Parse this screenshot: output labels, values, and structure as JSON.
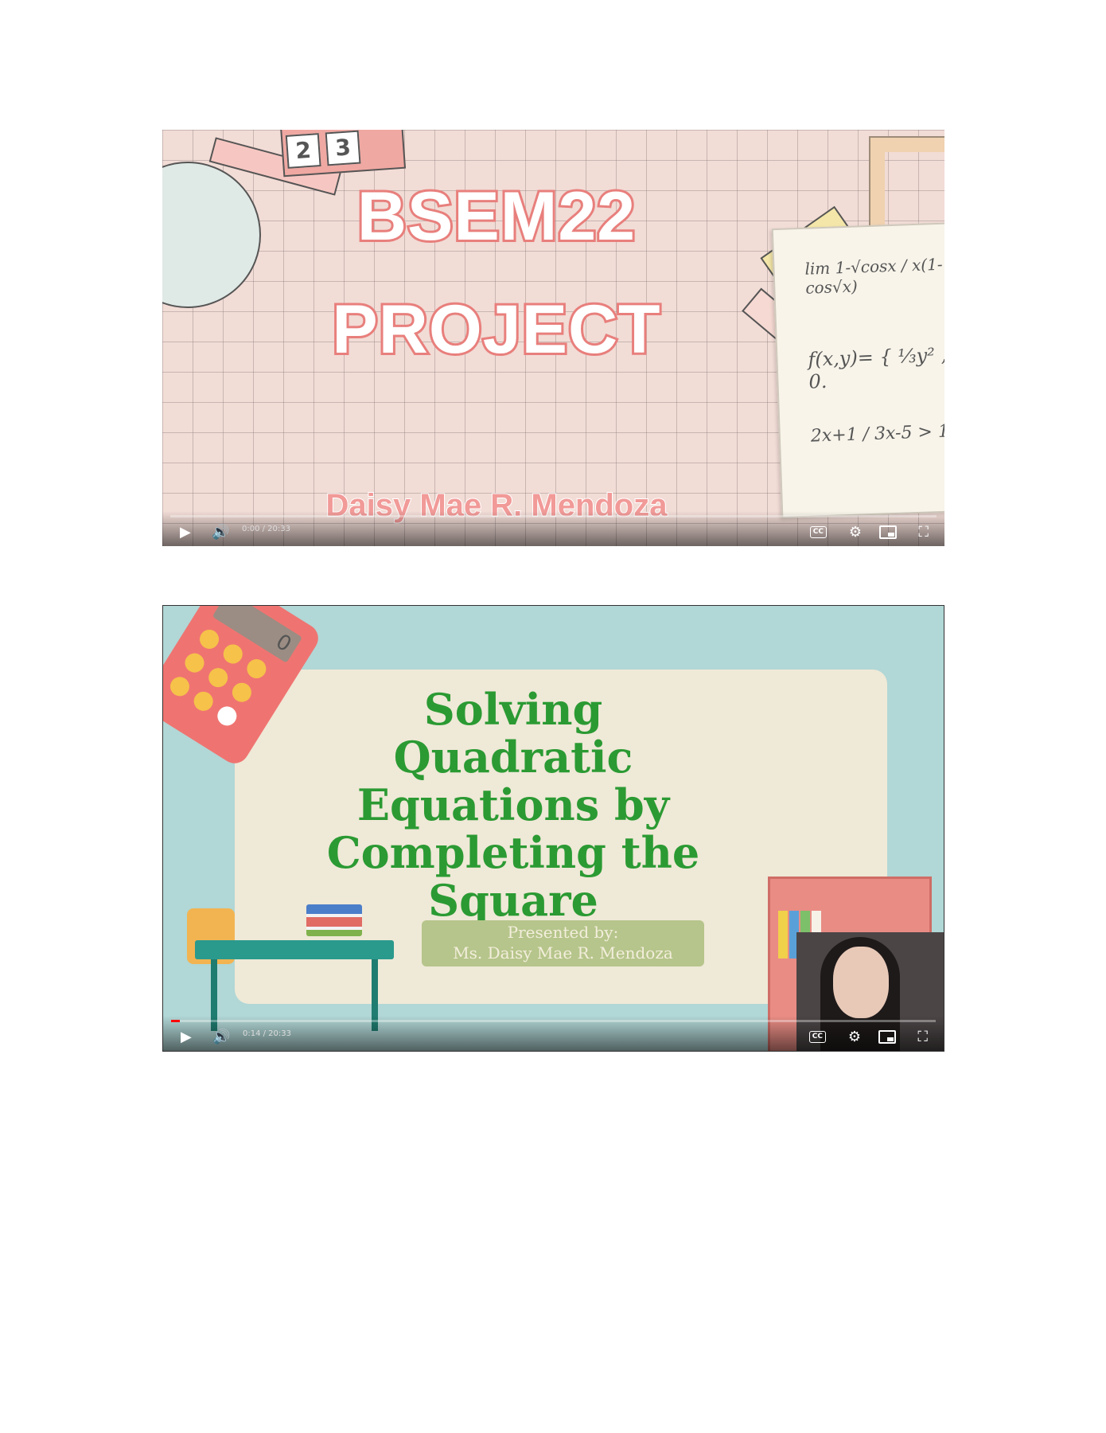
{
  "video1": {
    "title_line1": "BSEM22",
    "title_line2": "PROJECT",
    "author": "Daisy Mae R. Mendoza",
    "ruler_digits": [
      "2",
      "3"
    ],
    "math_1": "lim 1-√cosx / x(1-cos√x)",
    "math_2": "f(x,y)= { ⅓y² , 0.",
    "math_3": "2x+1 / 3x-5 > 1",
    "controls": {
      "play_icon": "▶",
      "volume_icon": "🔊",
      "time": "0:00 / 20:33",
      "cc_label": "CC",
      "gear_icon": "⚙",
      "fullscreen_icon": "⛶",
      "progress_fraction": 0.0
    }
  },
  "video2": {
    "title": "Solving Quadratic Equations by Completing the Square",
    "presented_by": "Presented by:",
    "presenter": "Ms. Daisy Mae R. Mendoza",
    "calculator_display": "0",
    "controls": {
      "play_icon": "▶",
      "volume_icon": "🔊",
      "time": "0:14 / 20:33",
      "cc_label": "CC",
      "gear_icon": "⚙",
      "fullscreen_icon": "⛶",
      "progress_fraction": 0.011
    }
  }
}
